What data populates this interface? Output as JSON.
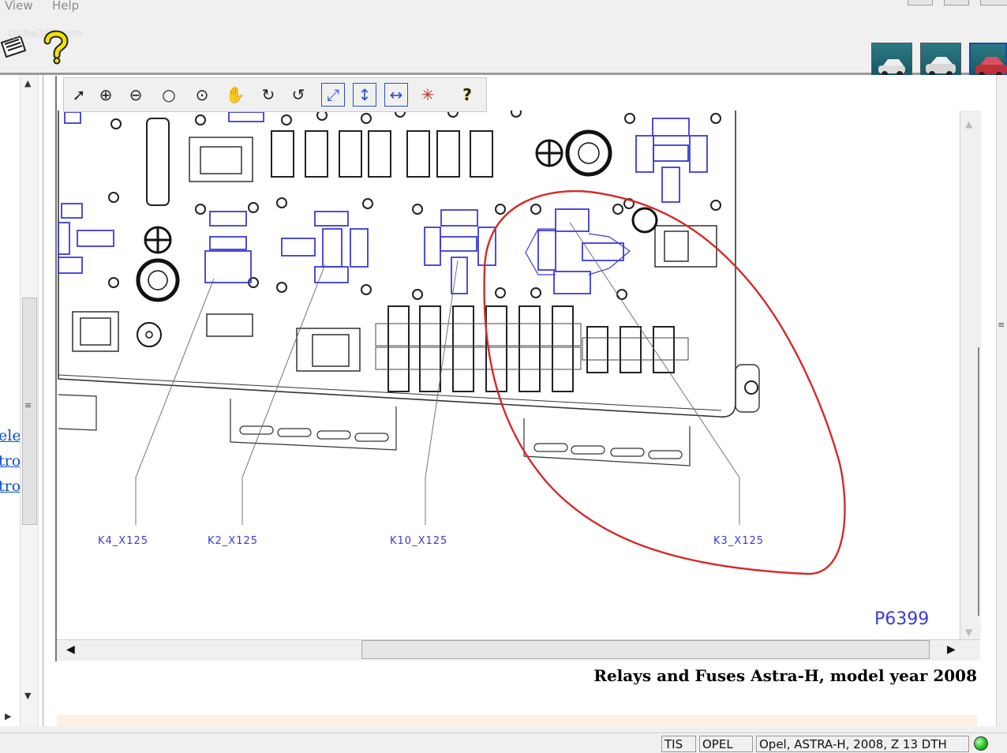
{
  "menu": {
    "items": [
      "View",
      "Help"
    ]
  },
  "watermark": "Qiche365.com",
  "left_links": [
    "ele",
    "tro",
    "tro"
  ],
  "viewer": {
    "tools": [
      "select-arrow",
      "zoom-in",
      "zoom-out",
      "zoom",
      "zoom-window",
      "pan-hand",
      "rotate-cw",
      "rotate-ccw",
      "fit-all",
      "fit-height",
      "fit-width",
      "highlight",
      "help"
    ]
  },
  "diagram": {
    "labels": [
      "K4_X125",
      "K2_X125",
      "K10_X125",
      "K3_X125"
    ],
    "figure_id": "P6399"
  },
  "caption": "Relays and Fuses Astra-H, model year 2008",
  "status": {
    "cell1": "TIS",
    "cell2": "OPEL",
    "cell3": "Opel, ASTRA-H, 2008, Z 13 DTH"
  },
  "colors": {
    "accent": "#3a3ad8",
    "annotation": "#d42a2a",
    "status_ok": "#1fc21f"
  }
}
